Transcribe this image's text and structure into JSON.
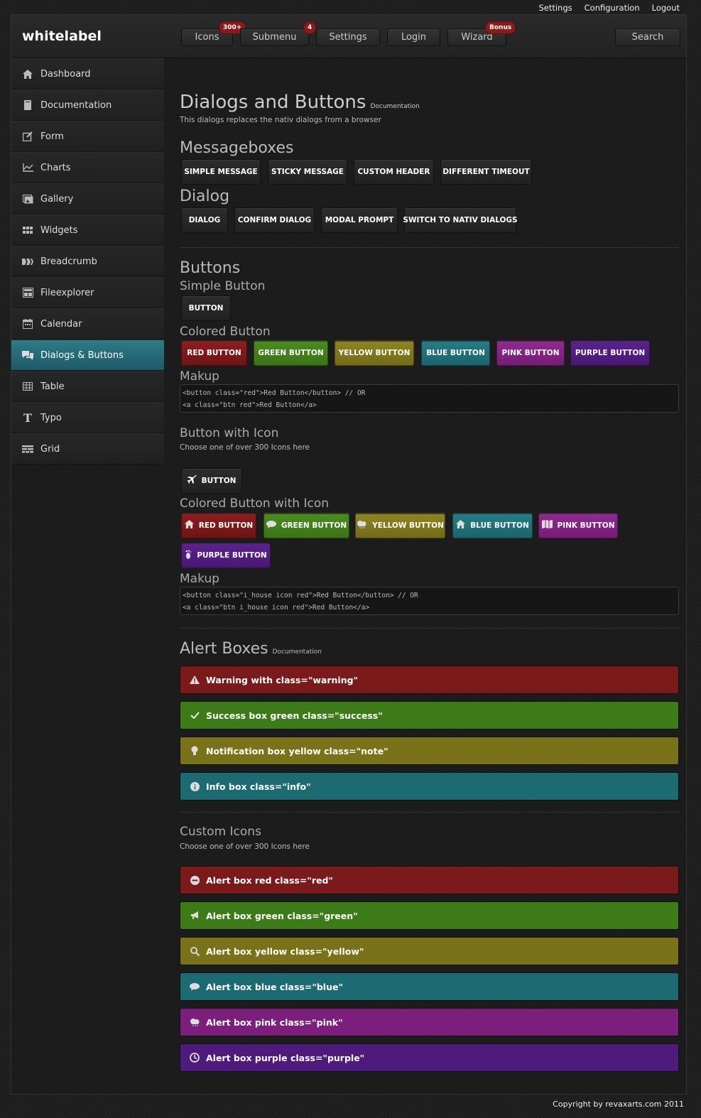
{
  "toplinks": [
    "Settings",
    "Configuration",
    "Logout"
  ],
  "header": {
    "logo": "whitelabel",
    "nav": [
      {
        "label": "Icons",
        "badge": "300+"
      },
      {
        "label": "Submenu",
        "badge": "4"
      },
      {
        "label": "Settings",
        "badge": ""
      },
      {
        "label": "Login",
        "badge": ""
      },
      {
        "label": "Wizard",
        "badge": "Bonus"
      }
    ],
    "search_label": "Search"
  },
  "sidebar": {
    "items": [
      {
        "label": "Dashboard",
        "icon": "house-icon"
      },
      {
        "label": "Documentation",
        "icon": "book-icon"
      },
      {
        "label": "Form",
        "icon": "edit-icon"
      },
      {
        "label": "Charts",
        "icon": "line-chart-icon"
      },
      {
        "label": "Gallery",
        "icon": "gallery-icon"
      },
      {
        "label": "Widgets",
        "icon": "widgets-icon"
      },
      {
        "label": "Breadcrumb",
        "icon": "breadcrumb-icon"
      },
      {
        "label": "Fileexplorer",
        "icon": "file-explorer-icon"
      },
      {
        "label": "Calendar",
        "icon": "calendar-icon"
      },
      {
        "label": "Dialogs & Buttons",
        "icon": "chat-bubbles-icon",
        "active": true
      },
      {
        "label": "Table",
        "icon": "table-icon"
      },
      {
        "label": "Typo",
        "icon": "typo-icon"
      },
      {
        "label": "Grid",
        "icon": "grid-icon"
      }
    ]
  },
  "main": {
    "title": "Dialogs and Buttons",
    "title_link": "Documentation",
    "subtitle": "This dialogs replaces the nativ dialogs from a browser",
    "messageboxes": {
      "heading": "Messageboxes",
      "buttons": [
        "SIMPLE MESSAGE",
        "STICKY MESSAGE",
        "CUSTOM HEADER",
        "DIFFERENT TIMEOUT"
      ]
    },
    "dialog": {
      "heading": "Dialog",
      "buttons": [
        "DIALOG",
        "CONFIRM DIALOG",
        "MODAL PROMPT",
        "SWITCH TO NATIV DIALOGS"
      ]
    },
    "buttons_section": {
      "heading": "Buttons",
      "simple_heading": "Simple Button",
      "simple_button": "BUTTON",
      "colored_heading": "Colored Button",
      "colored_buttons": [
        "RED BUTTON",
        "GREEN BUTTON",
        "YELLOW BUTTON",
        "BLUE BUTTON",
        "PINK BUTTON",
        "PURPLE BUTTON"
      ],
      "makeup_heading": "Makup",
      "makeup_lines": [
        "<button class=\"red\">Red Button</button> // OR",
        "<a class=\"btn red\">Red Button</a>"
      ],
      "icon_heading": "Button with Icon",
      "icon_sub": "Choose one of over 300 Icons here",
      "icon_button": "BUTTON",
      "colored_icon_heading": "Colored Button with Icon",
      "colored_icon_buttons": [
        {
          "label": "RED BUTTON",
          "icon": "house-icon"
        },
        {
          "label": "GREEN BUTTON",
          "icon": "speech-bubble-icon"
        },
        {
          "label": "YELLOW BUTTON",
          "icon": "cloud-icon"
        },
        {
          "label": "BLUE BUTTON",
          "icon": "house-icon"
        },
        {
          "label": "PINK BUTTON",
          "icon": "map-icon"
        },
        {
          "label": "PURPLE BUTTON",
          "icon": "foot-icon"
        }
      ],
      "makeup2_heading": "Makup",
      "makeup2_lines": [
        "<button class=\"i_house icon red\">Red Button</button> // OR",
        "<a class=\"btn i_house icon red\">Red Button</a>"
      ]
    },
    "alerts": {
      "heading": "Alert Boxes",
      "heading_link": "Documentation",
      "items": [
        {
          "text": "Warning with class=\"warning\"",
          "icon": "warning-icon",
          "color": "#7a1a1a"
        },
        {
          "text": "Success box green class=\"success\"",
          "icon": "check-icon",
          "color": "#3d7a18"
        },
        {
          "text": "Notification box yellow class=\"note\"",
          "icon": "lightbulb-icon",
          "color": "#7a7218"
        },
        {
          "text": "Info box class=\"info\"",
          "icon": "info-icon",
          "color": "#1c6b72"
        }
      ]
    },
    "custom_icons": {
      "heading": "Custom Icons",
      "sub": "Choose one of over 300 Icons here",
      "items": [
        {
          "text": "Alert box red class=\"red\"",
          "icon": "no-entry-icon",
          "color": "#7a1a1a"
        },
        {
          "text": "Alert box green class=\"green\"",
          "icon": "megaphone-icon",
          "color": "#3d7a18"
        },
        {
          "text": "Alert box yellow class=\"yellow\"",
          "icon": "magnifier-icon",
          "color": "#7a7218"
        },
        {
          "text": "Alert box blue class=\"blue\"",
          "icon": "speech-bubble-icon",
          "color": "#1c6b72"
        },
        {
          "text": "Alert box pink class=\"pink\"",
          "icon": "cloud-icon",
          "color": "#7c1f7c"
        },
        {
          "text": "Alert box purple class=\"purple\"",
          "icon": "clock-icon",
          "color": "#4e1a7c"
        }
      ]
    }
  },
  "footer": "Copyright by revaxarts.com 2011"
}
